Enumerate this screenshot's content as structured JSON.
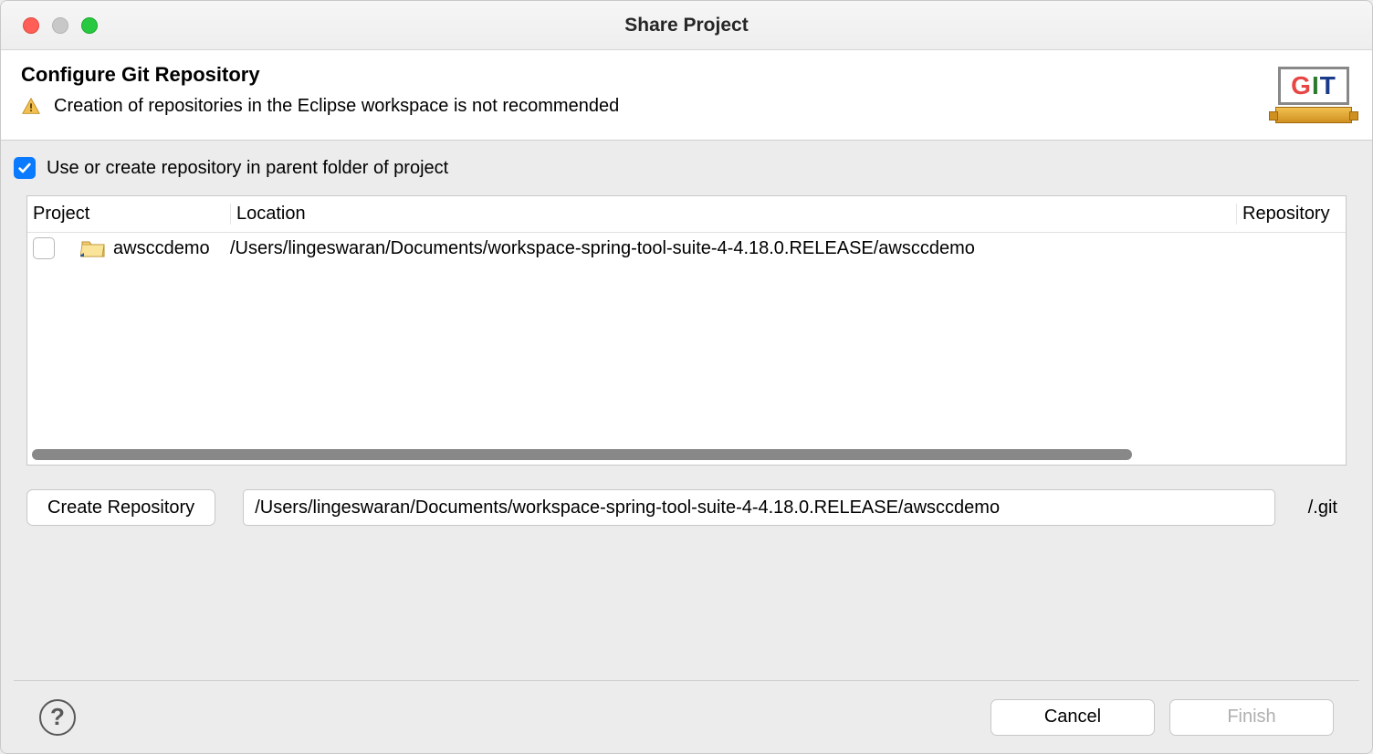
{
  "window": {
    "title": "Share Project"
  },
  "header": {
    "title": "Configure Git Repository",
    "warning_message": "Creation of repositories in the Eclipse workspace is not recommended"
  },
  "options": {
    "use_parent_folder": {
      "label": "Use or create repository in parent folder of project",
      "checked": true
    }
  },
  "table": {
    "columns": {
      "project": "Project",
      "location": "Location",
      "repository": "Repository"
    },
    "rows": [
      {
        "checked": false,
        "project": "awsccdemo",
        "location": "/Users/lingeswaran/Documents/workspace-spring-tool-suite-4-4.18.0.RELEASE/awsccdemo",
        "repository": ""
      }
    ]
  },
  "create_repo": {
    "button": "Create Repository",
    "path": "/Users/lingeswaran/Documents/workspace-spring-tool-suite-4-4.18.0.RELEASE/awsccdemo",
    "suffix": "/.git"
  },
  "footer": {
    "cancel": "Cancel",
    "finish": "Finish"
  }
}
